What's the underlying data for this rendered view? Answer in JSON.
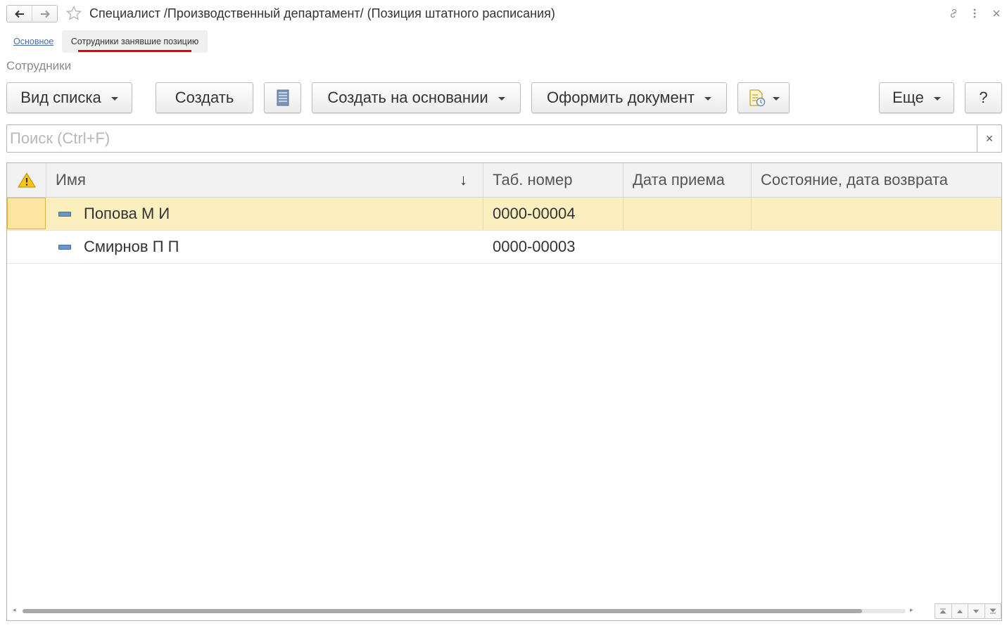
{
  "window": {
    "title": "Специалист /Производственный департамент/ (Позиция штатного расписания)"
  },
  "tabs": [
    {
      "label": "Основное",
      "active": false
    },
    {
      "label": "Сотрудники занявшие позицию",
      "active": true
    }
  ],
  "section_title": "Сотрудники",
  "toolbar": {
    "list_view": "Вид списка",
    "create": "Создать",
    "create_based_on": "Создать на основании",
    "make_document": "Оформить документ",
    "more": "Еще",
    "help": "?"
  },
  "search": {
    "placeholder": "Поиск (Ctrl+F)",
    "value": "",
    "clear": "×"
  },
  "table": {
    "columns": [
      "Имя",
      "Таб. номер",
      "Дата приема",
      "Состояние, дата возврата"
    ],
    "sort_indicator": "↓",
    "rows": [
      {
        "name": "Попова М И",
        "tab_number": "0000-00004",
        "hire_date": "",
        "status": "",
        "selected": true
      },
      {
        "name": "Смирнов П П",
        "tab_number": "0000-00003",
        "hire_date": "",
        "status": "",
        "selected": false
      }
    ]
  },
  "colors": {
    "selected_row": "#fbefbf",
    "tab_underline": "#e2001a",
    "link": "#4a6fb2"
  }
}
